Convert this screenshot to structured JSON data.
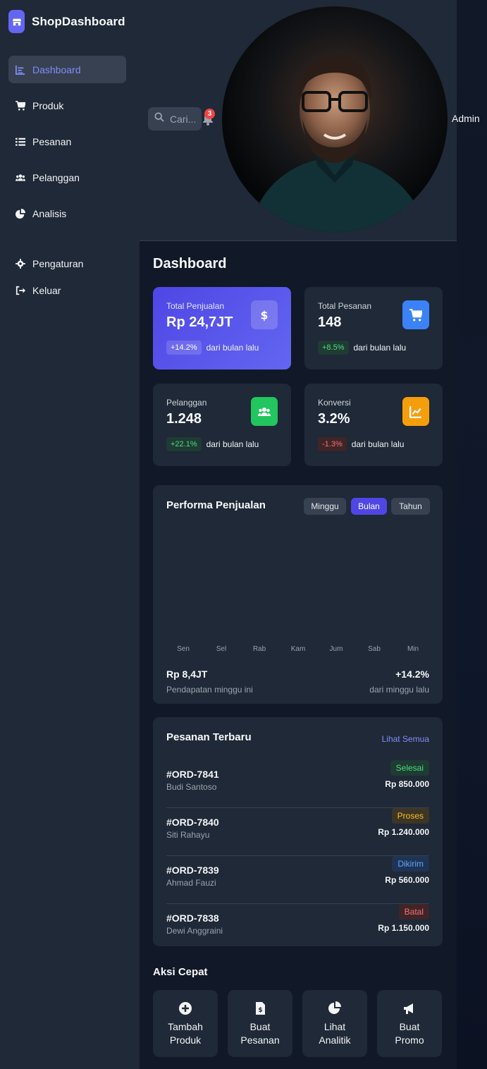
{
  "brand": {
    "name": "ShopDashboard",
    "color": "#6366f1"
  },
  "sidebar": {
    "items": [
      {
        "label": "Dashboard",
        "icon": "chart-icon",
        "active": true
      },
      {
        "label": "Produk",
        "icon": "cart-icon"
      },
      {
        "label": "Pesanan",
        "icon": "list-icon"
      },
      {
        "label": "Pelanggan",
        "icon": "users-icon"
      },
      {
        "label": "Analisis",
        "icon": "pie-icon"
      },
      {
        "label": "Pengaturan",
        "icon": "gear-icon"
      },
      {
        "label": "Keluar",
        "icon": "logout-icon"
      }
    ]
  },
  "header": {
    "search_placeholder": "Cari...",
    "notification_count": "3",
    "user_name": "Admin"
  },
  "main": {
    "title": "Dashboard",
    "stats": [
      {
        "label": "Total Penjualan",
        "value": "Rp 24,7JT",
        "change": "+14.2%",
        "note": "dari bulan lalu",
        "icon": "dollar-icon",
        "color": "#6366f1"
      },
      {
        "label": "Total Pesanan",
        "value": "148",
        "change": "+8.5%",
        "note": "dari bulan lalu",
        "icon": "cart-icon",
        "color": "#3b82f6"
      },
      {
        "label": "Pelanggan",
        "value": "1.248",
        "change": "+22.1%",
        "note": "dari bulan lalu",
        "icon": "users-icon",
        "color": "#22c55e"
      },
      {
        "label": "Konversi",
        "value": "3.2%",
        "change": "-1.3%",
        "note": "dari bulan lalu",
        "icon": "chart-line-icon",
        "color": "#f59e0b"
      }
    ],
    "performance": {
      "title": "Performa Penjualan",
      "periods": [
        "Minggu",
        "Bulan",
        "Tahun"
      ],
      "active_period": "Bulan",
      "days": [
        "Sen",
        "Sel",
        "Rab",
        "Kam",
        "Jum",
        "Sab",
        "Min"
      ],
      "revenue_value": "Rp 8,4JT",
      "revenue_label": "Pendapatan minggu ini",
      "revenue_change": "+14.2%",
      "revenue_change_label": "dari minggu lalu"
    },
    "orders": {
      "title": "Pesanan Terbaru",
      "view_all": "Lihat Semua",
      "rows": [
        {
          "id": "#ORD-7841",
          "customer": "Budi Santoso",
          "status": "Selesai",
          "amount": "Rp 850.000"
        },
        {
          "id": "#ORD-7840",
          "customer": "Siti Rahayu",
          "status": "Proses",
          "amount": "Rp 1.240.000"
        },
        {
          "id": "#ORD-7839",
          "customer": "Ahmad Fauzi",
          "status": "Dikirim",
          "amount": "Rp 560.000"
        },
        {
          "id": "#ORD-7838",
          "customer": "Dewi Anggraini",
          "status": "Batal",
          "amount": "Rp 1.150.000"
        }
      ]
    },
    "quick_actions": {
      "title": "Aksi Cepat",
      "items": [
        {
          "label": "Tambah\nProduk",
          "icon": "plus-circle-icon"
        },
        {
          "label": "Buat\nPesanan",
          "icon": "invoice-icon"
        },
        {
          "label": "Lihat\nAnalitik",
          "icon": "pie-icon"
        },
        {
          "label": "Buat\nPromo",
          "icon": "megaphone-icon"
        }
      ]
    }
  }
}
